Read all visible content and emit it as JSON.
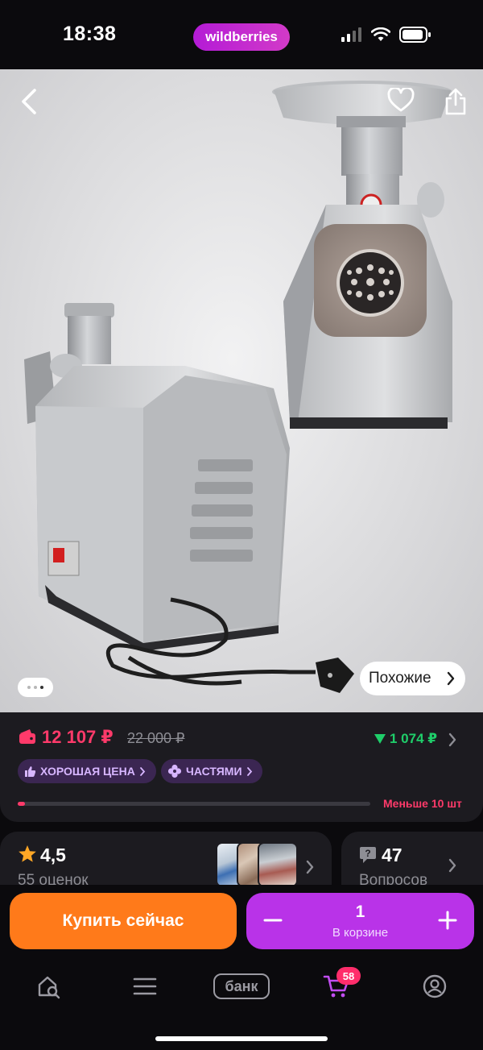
{
  "status_bar": {
    "time": "18:38",
    "brand": "wildberries"
  },
  "product": {
    "image_description": "stainless meat grinder",
    "carousel": {
      "count": 3,
      "active": 3
    },
    "similar_label": "Похожие"
  },
  "price": {
    "current": "12 107 ₽",
    "old": "22 000 ₽",
    "drop": "1 074 ₽",
    "badges": [
      "ХОРОШАЯ ЦЕНА",
      "ЧАСТЯМИ"
    ],
    "stock_fraction": 0.02,
    "stock_text": "Меньше 10 шт"
  },
  "reviews": {
    "rating": "4,5",
    "count_label": "55 оценок"
  },
  "questions": {
    "count": "47",
    "label": "Вопросов"
  },
  "buy": {
    "buy_now": "Купить сейчас",
    "qty": "1",
    "in_cart": "В корзине"
  },
  "tabbar": {
    "bank": "банк",
    "cart_badge": "58"
  },
  "colors": {
    "accent": "#b933e8",
    "price": "#ff3a6a",
    "buy": "#ff7a1a",
    "drop": "#1fce6a"
  }
}
